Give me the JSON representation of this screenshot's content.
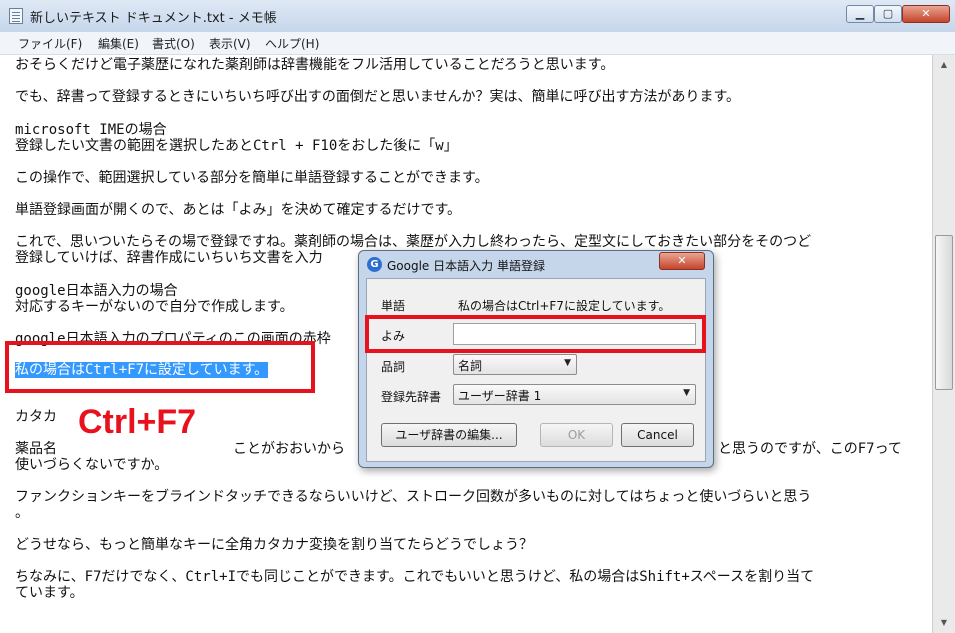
{
  "window": {
    "title": "新しいテキスト ドキュメント.txt - メモ帳",
    "close_glyph": "✕",
    "min_glyph": "▁",
    "max_glyph": "▢"
  },
  "menu": [
    "ファイル(F)",
    "編集(E)",
    "書式(O)",
    "表示(V)",
    "ヘルプ(H)"
  ],
  "document": {
    "lines": [
      "おそらくだけど電子薬歴になれた薬剤師は辞書機能をフル活用していることだろうと思います。",
      "でも、辞書って登録するときにいちいち呼び出すの面倒だと思いませんか？実は、簡単に呼び出す方法があります。",
      "microsoft IMEの場合",
      "登録したい文書の範囲を選択したあとCtrl + F10をおした後に「w」",
      "この操作で、範囲選択している部分を簡単に単語登録することができます。",
      "単語登録画面が開くので、あとは「よみ」を決めて確定するだけです。",
      "これで、思いついたらその場で登録ですね。薬剤師の場合は、薬歴が入力し終わったら、定型文にしておきたい部分をそのつど",
      "登録していけば、辞書作成にいちいち文書を入力",
      "google日本語入力の場合",
      "対応するキーがないので自分で作成します。",
      "google日本語入力のプロパティのこの画面の赤枠",
      "私の場合はCtrl+F7に設定しています。",
      "カタカ",
      "薬品名",
      "ことがおおいから",
      "と思うのですが、このF7って",
      "使いづらくないですか。",
      "ファンクションキーをブラインドタッチできるならいいけど、ストローク回数が多いものに対してはちょっと使いづらいと思う",
      "。",
      "どうせなら、もっと簡単なキーに全角カタカナ変換を割り当てたらどうでしょう？",
      "ちなみに、F7だけでなく、Ctrl+Iでも同じことができます。これでもいいと思うけど、私の場合はShift+スペースを割り当て",
      "ています。"
    ]
  },
  "annotation": {
    "text": "Ctrl+F7",
    "color": "#e8121f"
  },
  "dialog": {
    "title": "Google 日本語入力 単語登録",
    "icon_glyph": "G",
    "close_glyph": "✕",
    "word_label": "単語",
    "word_value": "私の場合はCtrl+F7に設定しています。",
    "reading_label": "よみ",
    "reading_value": "",
    "pos_label": "品詞",
    "pos_value": "名詞",
    "dict_label": "登録先辞書",
    "dict_value": "ユーザー辞書 1",
    "edit_button": "ユーザ辞書の編集...",
    "ok_button": "OK",
    "cancel_button": "Cancel"
  },
  "colors": {
    "selection": "#3399ff",
    "highlight": "#e8121f"
  }
}
